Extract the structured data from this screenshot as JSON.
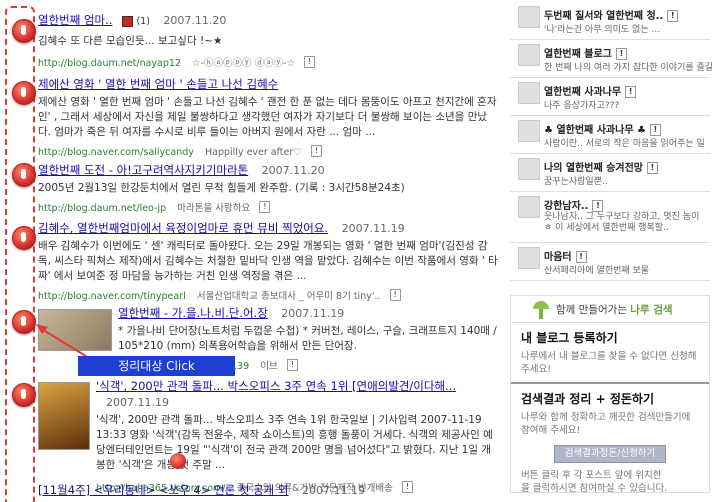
{
  "results": [
    {
      "title": "열한번째 엄마..",
      "extra": "(1)",
      "date": "2007.11.20",
      "desc": "김혜수 또 다른 모습인듯... 보고싶다 !~★",
      "url": "http://blog.daum.net/nayap12",
      "by": "☆-ⓗⓐⓟⓟⓨ ⓓⓐⓨ-☆"
    },
    {
      "title": "제에산 영화 ' 열한 번째 엄마 ' 손들고 나선 김혜수",
      "date": "2007.11.20",
      "desc": "제에산 영화 ' 열한 번째 엄마 ' 손들고 나선 김혜수 ' 괜전 한 푼 없는 데다 몸뚱이도 아프고 천지간에 혼자인' , 그래서 세상에서 자신을 제일 불쌍하다고 생각했던 여자가 자기보다 더 불쌍해 보이는 소년을 만났다. 엄마가 죽은 뒤 여자를 수시로 비루 들이는 아버지 원에서 자란 ... 엄마 ...",
      "url": "http://blog.naver.com/sallycandy",
      "by": "Happilly ever after♡"
    },
    {
      "title": "열한번째 도전 - 아!고구려역사지키기마라톤",
      "date": "2007.11.20",
      "desc": "2005년 2월13일 한강둔치에서 열린 무척 힘들게 완주함. (기록 : 3시간58분24초)",
      "url": "http://blog.daum.net/leo-jp",
      "by": "마라톤을 사랑하요"
    },
    {
      "title": "김혜수, 열한번째엄마에서 육정이엄마로 휴먼 뮤비 찍었어요.",
      "date": "2007.11.19",
      "desc": "배우 김혜수가 이번에도 ' 센' 캐릭터로 돌아왔다. 오는 29일 개봉되는 영화 ' 열한 번째 엄마'(김진성 감독, 씨스타 픽쳐스 제작)에서 김혜수는 처절한 밑바닥 인생 역을 맡았다. 김혜수는 이번 작품에서 영화 ' 타짜' 에서 보여준 정 마담을 능가하는 거친 인생 역정을 겪은 ...",
      "url": "http://blog.naver.com/tinypearl",
      "by": "서울산업대학교 총보대사 _ 어우미 8기 tiny'.."
    },
    {
      "title": "열한번째 - 가.을.나.비.단.어.장",
      "date": "2007.11.19",
      "desc": "* 가을나비 단어장(노트처럼 두껍운 수첩) * 커버천, 레이스, 구슬, 크래프트지 140매 / 105*210 (mm) 의폭용어학습을 위해서 만든 단어장.",
      "url": "...39",
      "by": "이브"
    },
    {
      "title": "'식객', 200만 관객 돌파... 박스오피스 3주 연속 1위 [연애의발견/이다해...",
      "date": "2007.11.19",
      "desc": "'식객', 200만 관객 돌파... 박스오피스 3주 연속 1위 한국일보 | 기사입력 2007-11-19 13:33 영화 '식객'(감독 전윤수, 제작 쇼이스트)의 흥행 돌풍이 거세다. 식객의 제공사인 예당엔터테인먼트는 19일 \"'식객'이 전국 관객 200만 명을 넘어섰다\"고 밝혔다. 지난 1일 개봉한 '식객'은 개봉 첫 주말 ...",
      "url": "http://haha365.tistory.com/",
      "by": "중국수입 의류&가방 전문제작 번개배송"
    },
    {
      "title": "[11월4주] <우리동네> <쏘우 4> 언론 첫 공개 외",
      "date": "2007.11.19"
    }
  ],
  "callout": "정리대상 Click",
  "sidebar": [
    {
      "title": "두번째 질서와 열한번째 청..",
      "sub": "'나'라는건 아무 의미도 없는 ..."
    },
    {
      "title": "열한번째 블로그",
      "sub": "한 번째 나의 여러 가지 잡다한 이야기를 즐길"
    },
    {
      "title": "열한번째 사과나무",
      "sub": "나주 응상가자고???"
    },
    {
      "title": "♣ 열한번째 사과나무 ♣",
      "sub": "사랑이란.. 서로의 작은 마음을 읽어주는 일"
    },
    {
      "title": "나의 열한번째 승겨전망",
      "sub": "꿈꾸는사람일뿐.."
    },
    {
      "title": "강한남자..",
      "sub": "웃나남자.. 그 누구보다 강하고, 멋진 놈이 ㅎ 이 세상에서 열한번째 행복할.."
    },
    {
      "title": "마음터",
      "sub": "산서페리아에 열한번째 보물"
    }
  ],
  "naru": {
    "header_prefix": "함께 만들어가는 ",
    "header_brand": "나루 검색",
    "register_title": "내 블로그 등록하기",
    "register_desc": "나루에서 내 블로그를 찾을 수 없다면 신청해 주세요!",
    "organize_title": "검색결과 정리 + 정돈하기",
    "organize_desc": "나루와 함께 정확하고 깨끗한 검색만들기에 참여해 주세요!",
    "organize_button": "검색결과정돈/신청하기",
    "organize_note": "버튼 클릭 후 각 포스트 앞에 위치한 을 클릭하시면 참여하실 수 있습니다."
  }
}
